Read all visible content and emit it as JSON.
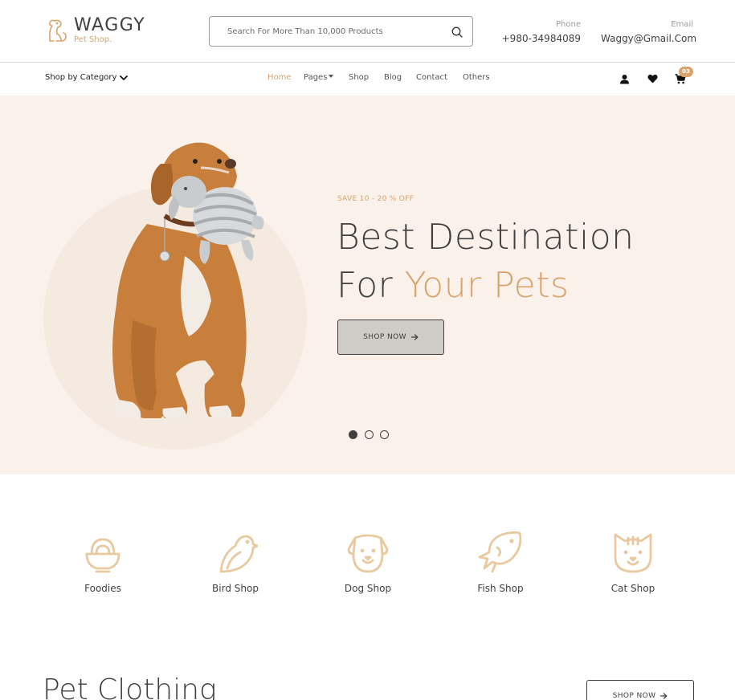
{
  "header": {
    "brand_name": "WAGGY",
    "brand_tagline": "Pet Shop.",
    "search": {
      "placeholder": "Search For More Than 10,000 Products"
    },
    "phone": {
      "label": "Phone",
      "value": "+980-34984089"
    },
    "email": {
      "label": "Email",
      "value": "Waggy@Gmail.Com"
    }
  },
  "nav": {
    "category_label": "Shop by Category",
    "items": [
      {
        "label": "Home",
        "active": true
      },
      {
        "label": "Pages",
        "dropdown": true
      },
      {
        "label": "Shop"
      },
      {
        "label": "Blog"
      },
      {
        "label": "Contact"
      },
      {
        "label": "Others"
      }
    ],
    "cart_count": "03",
    "icons": [
      "user-icon",
      "heart-icon",
      "cart-icon"
    ]
  },
  "hero": {
    "save_text": "SAVE 10 - 20 % OFF",
    "title_line1": "Best Destination",
    "title_line2_plain": "For",
    "title_line2_accent": "Your Pets",
    "button_label": "SHOP NOW",
    "slide_count": 3,
    "active_slide": 1
  },
  "categories": [
    {
      "label": "Foodies",
      "icon": "food-bowl-icon"
    },
    {
      "label": "Bird Shop",
      "icon": "bird-icon"
    },
    {
      "label": "Dog Shop",
      "icon": "dog-icon"
    },
    {
      "label": "Fish Shop",
      "icon": "fish-icon"
    },
    {
      "label": "Cat Shop",
      "icon": "cat-icon"
    }
  ],
  "section": {
    "title": "Pet Clothing",
    "button_label": "SHOP NOW"
  },
  "colors": {
    "accent": "#d9a46b",
    "text": "#41403e",
    "hero_bg": "#f9f1ea"
  }
}
